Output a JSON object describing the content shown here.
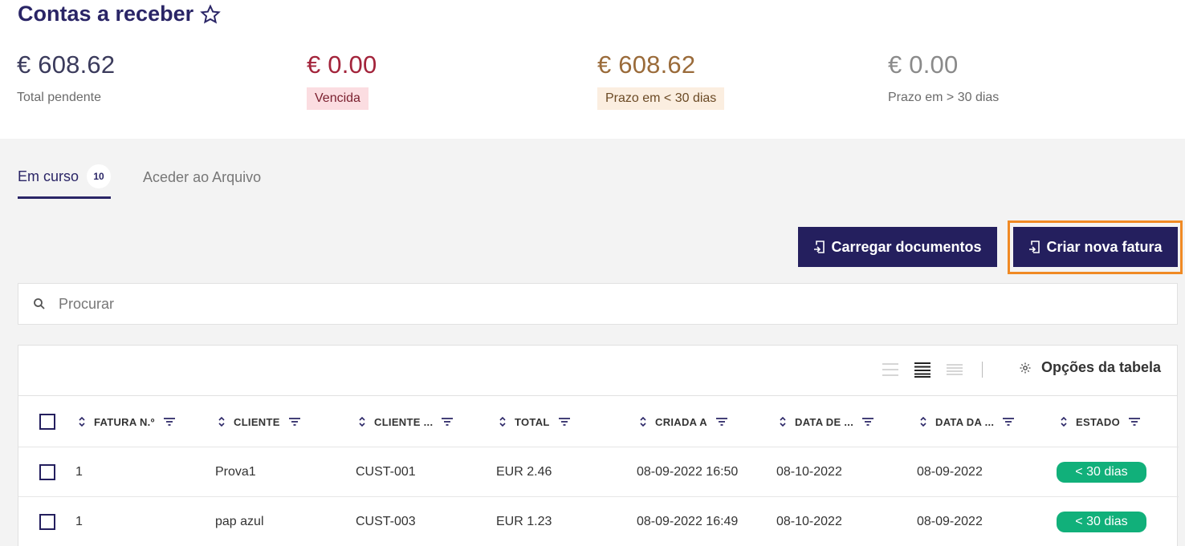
{
  "page": {
    "title": "Contas a receber"
  },
  "stats": [
    {
      "amount": "€ 608.62",
      "label": "Total pendente",
      "color": "#3b3b5c"
    },
    {
      "amount": "€ 0.00",
      "label": "Vencida",
      "color": "#a3243b",
      "badge_bg": "#fbdde1"
    },
    {
      "amount": "€ 608.62",
      "label": "Prazo em < 30 dias",
      "color": "#9a6b3a",
      "badge_bg": "#fbeee0"
    },
    {
      "amount": "€ 0.00",
      "label": "Prazo em > 30 dias",
      "color": "#8a8a8a"
    }
  ],
  "tabs": [
    {
      "label": "Em curso",
      "count": "10",
      "active": true
    },
    {
      "label": "Aceder ao Arquivo"
    }
  ],
  "actions": {
    "upload_label": "Carregar documentos",
    "create_label": "Criar nova fatura"
  },
  "search": {
    "placeholder": "Procurar"
  },
  "table": {
    "options_label": "Opções da tabela",
    "columns": [
      "FATURA N.º",
      "CLIENTE",
      "CLIENTE ...",
      "TOTAL",
      "CRIADA A",
      "DATA DE ...",
      "DATA DA ...",
      "ESTADO"
    ],
    "rows": [
      [
        "1",
        "Prova1",
        "CUST-001",
        "EUR 2.46",
        "08-09-2022 16:50",
        "08-10-2022",
        "08-09-2022",
        "< 30 dias"
      ],
      [
        "1",
        "pap azul",
        "CUST-003",
        "EUR 1.23",
        "08-09-2022 16:49",
        "08-10-2022",
        "08-09-2022",
        "< 30 dias"
      ]
    ]
  },
  "colors": {
    "primary": "#241f5e",
    "status_ok": "#11b07a",
    "highlight": "#f08a24"
  }
}
